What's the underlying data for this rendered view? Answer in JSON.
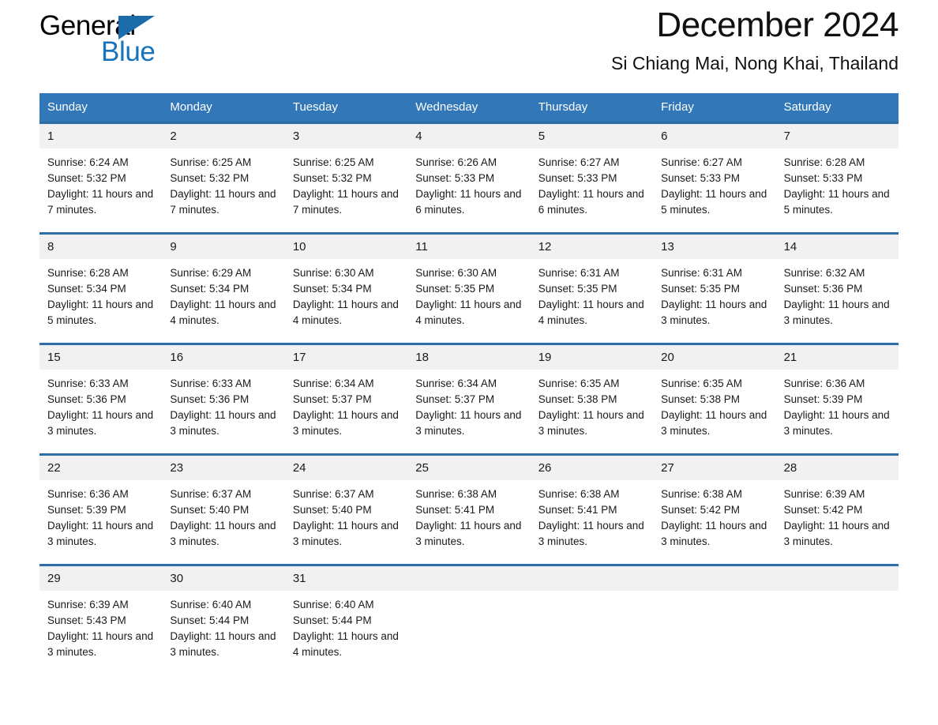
{
  "brand": {
    "name_part1": "General",
    "name_part2": "Blue",
    "accent_color": "#1574bb",
    "triangle_color": "#1b6ca8"
  },
  "header": {
    "month_title": "December 2024",
    "location": "Si Chiang Mai, Nong Khai, Thailand"
  },
  "calendar": {
    "header_bg": "#3277b8",
    "row_divider_color": "#2e6da8",
    "daynum_bg": "#f1f1f1",
    "weekdays": [
      "Sunday",
      "Monday",
      "Tuesday",
      "Wednesday",
      "Thursday",
      "Friday",
      "Saturday"
    ],
    "weeks": [
      {
        "days": [
          {
            "date": "1",
            "sunrise": "Sunrise: 6:24 AM",
            "sunset": "Sunset: 5:32 PM",
            "daylight": "Daylight: 11 hours and 7 minutes."
          },
          {
            "date": "2",
            "sunrise": "Sunrise: 6:25 AM",
            "sunset": "Sunset: 5:32 PM",
            "daylight": "Daylight: 11 hours and 7 minutes."
          },
          {
            "date": "3",
            "sunrise": "Sunrise: 6:25 AM",
            "sunset": "Sunset: 5:32 PM",
            "daylight": "Daylight: 11 hours and 7 minutes."
          },
          {
            "date": "4",
            "sunrise": "Sunrise: 6:26 AM",
            "sunset": "Sunset: 5:33 PM",
            "daylight": "Daylight: 11 hours and 6 minutes."
          },
          {
            "date": "5",
            "sunrise": "Sunrise: 6:27 AM",
            "sunset": "Sunset: 5:33 PM",
            "daylight": "Daylight: 11 hours and 6 minutes."
          },
          {
            "date": "6",
            "sunrise": "Sunrise: 6:27 AM",
            "sunset": "Sunset: 5:33 PM",
            "daylight": "Daylight: 11 hours and 5 minutes."
          },
          {
            "date": "7",
            "sunrise": "Sunrise: 6:28 AM",
            "sunset": "Sunset: 5:33 PM",
            "daylight": "Daylight: 11 hours and 5 minutes."
          }
        ]
      },
      {
        "days": [
          {
            "date": "8",
            "sunrise": "Sunrise: 6:28 AM",
            "sunset": "Sunset: 5:34 PM",
            "daylight": "Daylight: 11 hours and 5 minutes."
          },
          {
            "date": "9",
            "sunrise": "Sunrise: 6:29 AM",
            "sunset": "Sunset: 5:34 PM",
            "daylight": "Daylight: 11 hours and 4 minutes."
          },
          {
            "date": "10",
            "sunrise": "Sunrise: 6:30 AM",
            "sunset": "Sunset: 5:34 PM",
            "daylight": "Daylight: 11 hours and 4 minutes."
          },
          {
            "date": "11",
            "sunrise": "Sunrise: 6:30 AM",
            "sunset": "Sunset: 5:35 PM",
            "daylight": "Daylight: 11 hours and 4 minutes."
          },
          {
            "date": "12",
            "sunrise": "Sunrise: 6:31 AM",
            "sunset": "Sunset: 5:35 PM",
            "daylight": "Daylight: 11 hours and 4 minutes."
          },
          {
            "date": "13",
            "sunrise": "Sunrise: 6:31 AM",
            "sunset": "Sunset: 5:35 PM",
            "daylight": "Daylight: 11 hours and 3 minutes."
          },
          {
            "date": "14",
            "sunrise": "Sunrise: 6:32 AM",
            "sunset": "Sunset: 5:36 PM",
            "daylight": "Daylight: 11 hours and 3 minutes."
          }
        ]
      },
      {
        "days": [
          {
            "date": "15",
            "sunrise": "Sunrise: 6:33 AM",
            "sunset": "Sunset: 5:36 PM",
            "daylight": "Daylight: 11 hours and 3 minutes."
          },
          {
            "date": "16",
            "sunrise": "Sunrise: 6:33 AM",
            "sunset": "Sunset: 5:36 PM",
            "daylight": "Daylight: 11 hours and 3 minutes."
          },
          {
            "date": "17",
            "sunrise": "Sunrise: 6:34 AM",
            "sunset": "Sunset: 5:37 PM",
            "daylight": "Daylight: 11 hours and 3 minutes."
          },
          {
            "date": "18",
            "sunrise": "Sunrise: 6:34 AM",
            "sunset": "Sunset: 5:37 PM",
            "daylight": "Daylight: 11 hours and 3 minutes."
          },
          {
            "date": "19",
            "sunrise": "Sunrise: 6:35 AM",
            "sunset": "Sunset: 5:38 PM",
            "daylight": "Daylight: 11 hours and 3 minutes."
          },
          {
            "date": "20",
            "sunrise": "Sunrise: 6:35 AM",
            "sunset": "Sunset: 5:38 PM",
            "daylight": "Daylight: 11 hours and 3 minutes."
          },
          {
            "date": "21",
            "sunrise": "Sunrise: 6:36 AM",
            "sunset": "Sunset: 5:39 PM",
            "daylight": "Daylight: 11 hours and 3 minutes."
          }
        ]
      },
      {
        "days": [
          {
            "date": "22",
            "sunrise": "Sunrise: 6:36 AM",
            "sunset": "Sunset: 5:39 PM",
            "daylight": "Daylight: 11 hours and 3 minutes."
          },
          {
            "date": "23",
            "sunrise": "Sunrise: 6:37 AM",
            "sunset": "Sunset: 5:40 PM",
            "daylight": "Daylight: 11 hours and 3 minutes."
          },
          {
            "date": "24",
            "sunrise": "Sunrise: 6:37 AM",
            "sunset": "Sunset: 5:40 PM",
            "daylight": "Daylight: 11 hours and 3 minutes."
          },
          {
            "date": "25",
            "sunrise": "Sunrise: 6:38 AM",
            "sunset": "Sunset: 5:41 PM",
            "daylight": "Daylight: 11 hours and 3 minutes."
          },
          {
            "date": "26",
            "sunrise": "Sunrise: 6:38 AM",
            "sunset": "Sunset: 5:41 PM",
            "daylight": "Daylight: 11 hours and 3 minutes."
          },
          {
            "date": "27",
            "sunrise": "Sunrise: 6:38 AM",
            "sunset": "Sunset: 5:42 PM",
            "daylight": "Daylight: 11 hours and 3 minutes."
          },
          {
            "date": "28",
            "sunrise": "Sunrise: 6:39 AM",
            "sunset": "Sunset: 5:42 PM",
            "daylight": "Daylight: 11 hours and 3 minutes."
          }
        ]
      },
      {
        "days": [
          {
            "date": "29",
            "sunrise": "Sunrise: 6:39 AM",
            "sunset": "Sunset: 5:43 PM",
            "daylight": "Daylight: 11 hours and 3 minutes."
          },
          {
            "date": "30",
            "sunrise": "Sunrise: 6:40 AM",
            "sunset": "Sunset: 5:44 PM",
            "daylight": "Daylight: 11 hours and 3 minutes."
          },
          {
            "date": "31",
            "sunrise": "Sunrise: 6:40 AM",
            "sunset": "Sunset: 5:44 PM",
            "daylight": "Daylight: 11 hours and 4 minutes."
          },
          {
            "date": "",
            "sunrise": "",
            "sunset": "",
            "daylight": ""
          },
          {
            "date": "",
            "sunrise": "",
            "sunset": "",
            "daylight": ""
          },
          {
            "date": "",
            "sunrise": "",
            "sunset": "",
            "daylight": ""
          },
          {
            "date": "",
            "sunrise": "",
            "sunset": "",
            "daylight": ""
          }
        ]
      }
    ]
  }
}
